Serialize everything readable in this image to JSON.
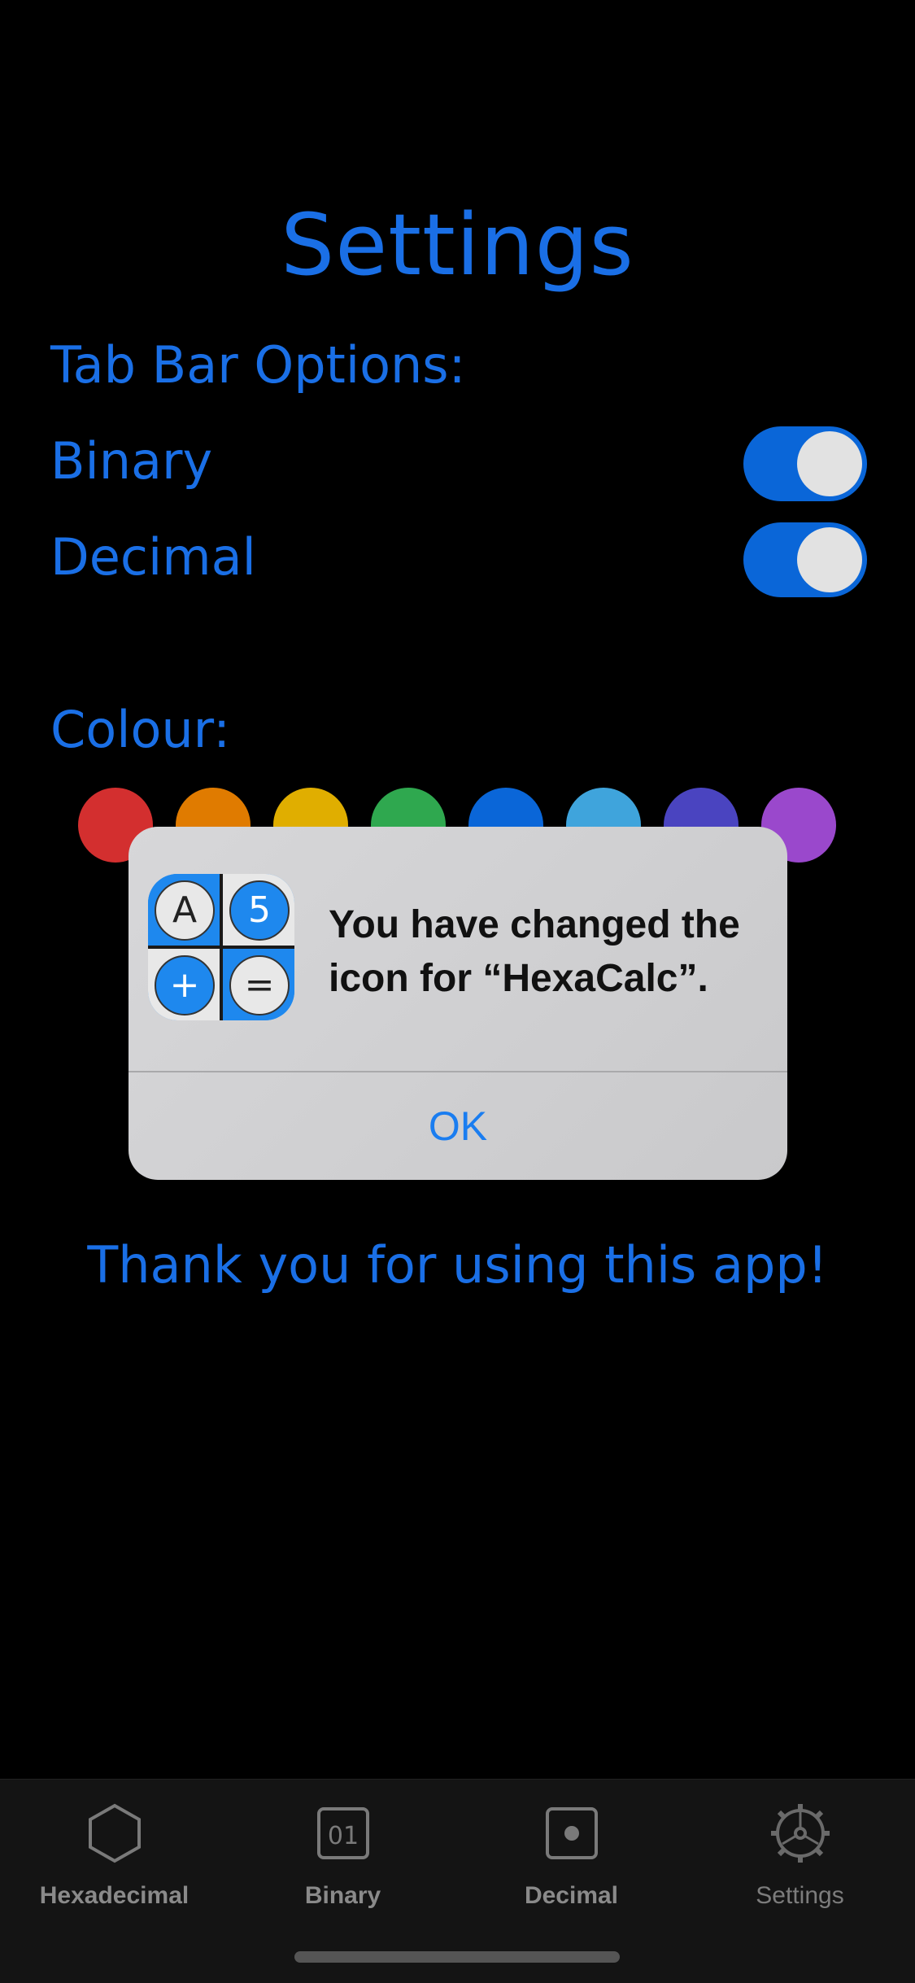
{
  "page": {
    "title": "Settings",
    "tab_bar_options_label": "Tab Bar Options:",
    "colour_label": "Colour:",
    "thanks": "Thank you for using this app!"
  },
  "toggles": [
    {
      "label": "Binary",
      "on": true
    },
    {
      "label": "Decimal",
      "on": true
    }
  ],
  "colours": [
    "#d32f2f",
    "#e07b00",
    "#e0ae00",
    "#2fa84f",
    "#0a66d8",
    "#3fa4dc",
    "#4a44c0",
    "#9a48cc"
  ],
  "accent": "#1a6fe6",
  "alert": {
    "message": "You have changed the icon for “HexaCalc”.",
    "ok_label": "OK",
    "icon": {
      "a": "A",
      "b": "5",
      "c": "+",
      "d": "="
    }
  },
  "tabbar": {
    "items": [
      {
        "label": "Hexadecimal",
        "icon": "hexagon-icon"
      },
      {
        "label": "Binary",
        "icon": "binary-01-icon",
        "glyph": "01"
      },
      {
        "label": "Decimal",
        "icon": "decimal-dot-icon"
      },
      {
        "label": "Settings",
        "icon": "gear-icon"
      }
    ],
    "selected": "Settings"
  }
}
